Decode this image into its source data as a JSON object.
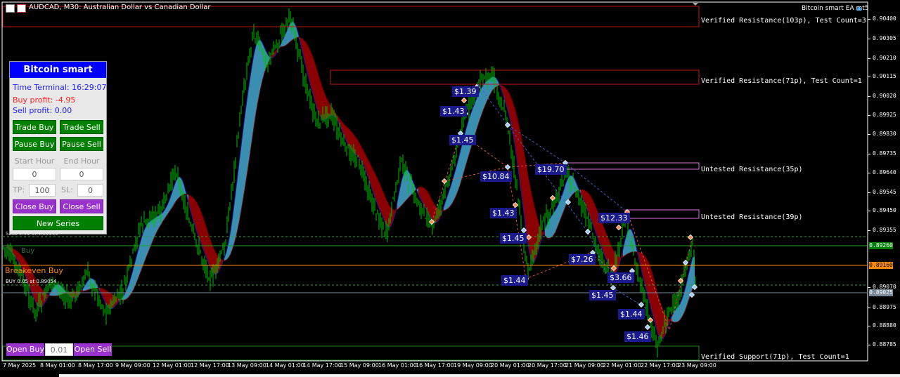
{
  "title": {
    "symbol_line": "AUDCAD, M30:  Australian Dollar vs Canadian Dollar",
    "ea_label": "Bitcoin smart EA mt5"
  },
  "price_axis": [
    "0.90400",
    "0.90305",
    "0.90210",
    "0.90115",
    "0.90020",
    "0.89925",
    "0.89830",
    "0.89735",
    "0.89640",
    "0.89545",
    "0.89450",
    "0.89355",
    "0.89070",
    "0.88975",
    "0.88880",
    "0.88785"
  ],
  "price_badges": [
    {
      "value": "0.89260",
      "color": "#008000"
    },
    {
      "value": "0.89160",
      "color": "#ff8c00"
    },
    {
      "value": "0.89025",
      "color": "#778899"
    }
  ],
  "time_axis": [
    "7 May 2025",
    "8 May 01:00",
    "8 May 17:00",
    "9 May 09:00",
    "12 May 01:00",
    "12 May 17:00",
    "13 May 09:00",
    "14 May 01:00",
    "14 May 17:00",
    "15 May 09:00",
    "16 May 01:00",
    "16 May 17:00",
    "19 May 09:00",
    "20 May 01:00",
    "20 May 17:00",
    "21 May 09:00",
    "22 May 01:00",
    "22 May 17:00",
    "23 May 09:00"
  ],
  "zones": [
    {
      "label": "Verified Resistance(103p), Test Count=3",
      "color": "#d02020"
    },
    {
      "label": "Verified Resistance(71p), Test Count=1",
      "color": "#d02020"
    },
    {
      "label": "Untested Resistance(35p)",
      "color": "#e070e0"
    },
    {
      "label": "Untested Resistance(39p)",
      "color": "#e070e0"
    },
    {
      "label": "Verified Support(71p), Test Count=1",
      "color": "#208020"
    }
  ],
  "trade_labels": [
    "$1.39",
    "$1.43",
    "$1.45",
    "$10.84",
    "$19.70",
    "$1.43",
    "$1.45",
    "$1.44",
    "$7.26",
    "$12.33",
    "$3.66",
    "$1.45",
    "$1.44",
    "$1.46"
  ],
  "line_labels": {
    "sell_line": "SELL 0.01 at 0.89305",
    "buy_ghost": "Buy",
    "breakeven": "Breakeven Buy",
    "buy_line": "BUY 0.05 at 0.89054"
  },
  "panel": {
    "title": "Bitcoin smart",
    "time_terminal": "Time Terminal: 16:29:07",
    "buy_profit": "Buy profit: -4.95",
    "sell_profit": "Sell profit: 0.00",
    "trade_buy": "Trade Buy",
    "trade_sell": "Trade Sell",
    "pause_buy": "Pause Buy",
    "pause_sell": "Pause Sell",
    "start_hour_label": "Start Hour",
    "end_hour_label": "End Hour",
    "start_hour_value": "0",
    "end_hour_value": "0",
    "tp_label": "TP:",
    "tp_value": "100",
    "sl_label": "SL:",
    "sl_value": "0",
    "close_buy": "Close Buy",
    "close_sell": "Close Sell",
    "new_series": "New Series"
  },
  "bottom_controls": {
    "open_buy": "Open Buy",
    "lot_value": "0.01",
    "open_sell": "Open Sell"
  },
  "colors": {
    "candles": "#00c000",
    "bull_band": "#3a8fb0",
    "bear_band": "#8b0000",
    "panel_title": "#0000ff",
    "green_button": "#008000",
    "purple_button": "#9932cc"
  }
}
